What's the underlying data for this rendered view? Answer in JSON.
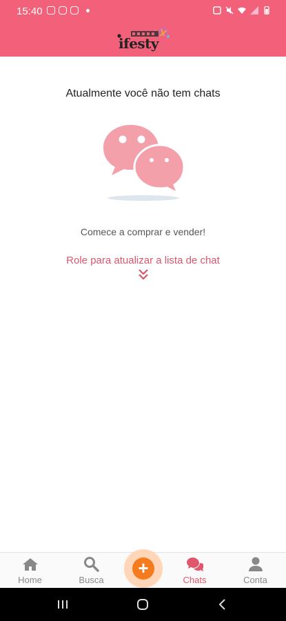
{
  "status_bar": {
    "time": "15:40"
  },
  "header": {
    "logo_text": "ifesty",
    "logo_bg": "#f2607a"
  },
  "main": {
    "empty_title": "Atualmente você não tem chats",
    "subtitle": "Comece a comprar e vender!",
    "refresh_hint": "Role para atualizar a lista de chat"
  },
  "bottom_nav": {
    "items": [
      {
        "label": "Home",
        "icon": "home-icon",
        "active": false
      },
      {
        "label": "Busca",
        "icon": "search-icon",
        "active": false
      },
      {
        "label": "Chats",
        "icon": "chat-bubbles-icon",
        "active": true
      },
      {
        "label": "Conta",
        "icon": "person-icon",
        "active": false
      }
    ],
    "fab_label": "+",
    "fab_color": "#f47b1e",
    "active_color": "#e0566c"
  }
}
